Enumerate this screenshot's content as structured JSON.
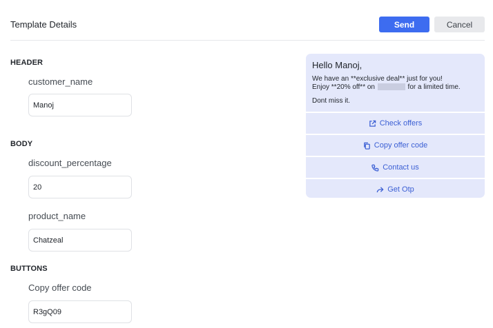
{
  "header": {
    "title": "Template Details",
    "send_label": "Send",
    "cancel_label": "Cancel"
  },
  "form": {
    "header_section": "HEADER",
    "body_section": "BODY",
    "buttons_section": "BUTTONS",
    "fields": [
      {
        "label": "customer_name",
        "value": "Manoj"
      },
      {
        "label": "discount_percentage",
        "value": "20"
      },
      {
        "label": "product_name",
        "value": "Chatzeal"
      },
      {
        "label": "Copy offer code",
        "value": "R3gQ09"
      }
    ]
  },
  "preview": {
    "greeting": "Hello Manoj,",
    "line1": "We have an **exclusive deal** just for you!",
    "line2_a": "Enjoy **20% off** on ",
    "line2_b": " for a limited time.",
    "closing": "Dont miss it.",
    "buttons": [
      {
        "label": "Check offers",
        "icon": "external-link-icon"
      },
      {
        "label": "Copy offer code",
        "icon": "copy-icon"
      },
      {
        "label": "Contact us",
        "icon": "phone-icon"
      },
      {
        "label": "Get Otp",
        "icon": "share-arrow-icon"
      }
    ]
  },
  "colors": {
    "accent": "#3d6cf0",
    "preview_bg": "#e4e8fb",
    "link": "#3b5fd4"
  }
}
